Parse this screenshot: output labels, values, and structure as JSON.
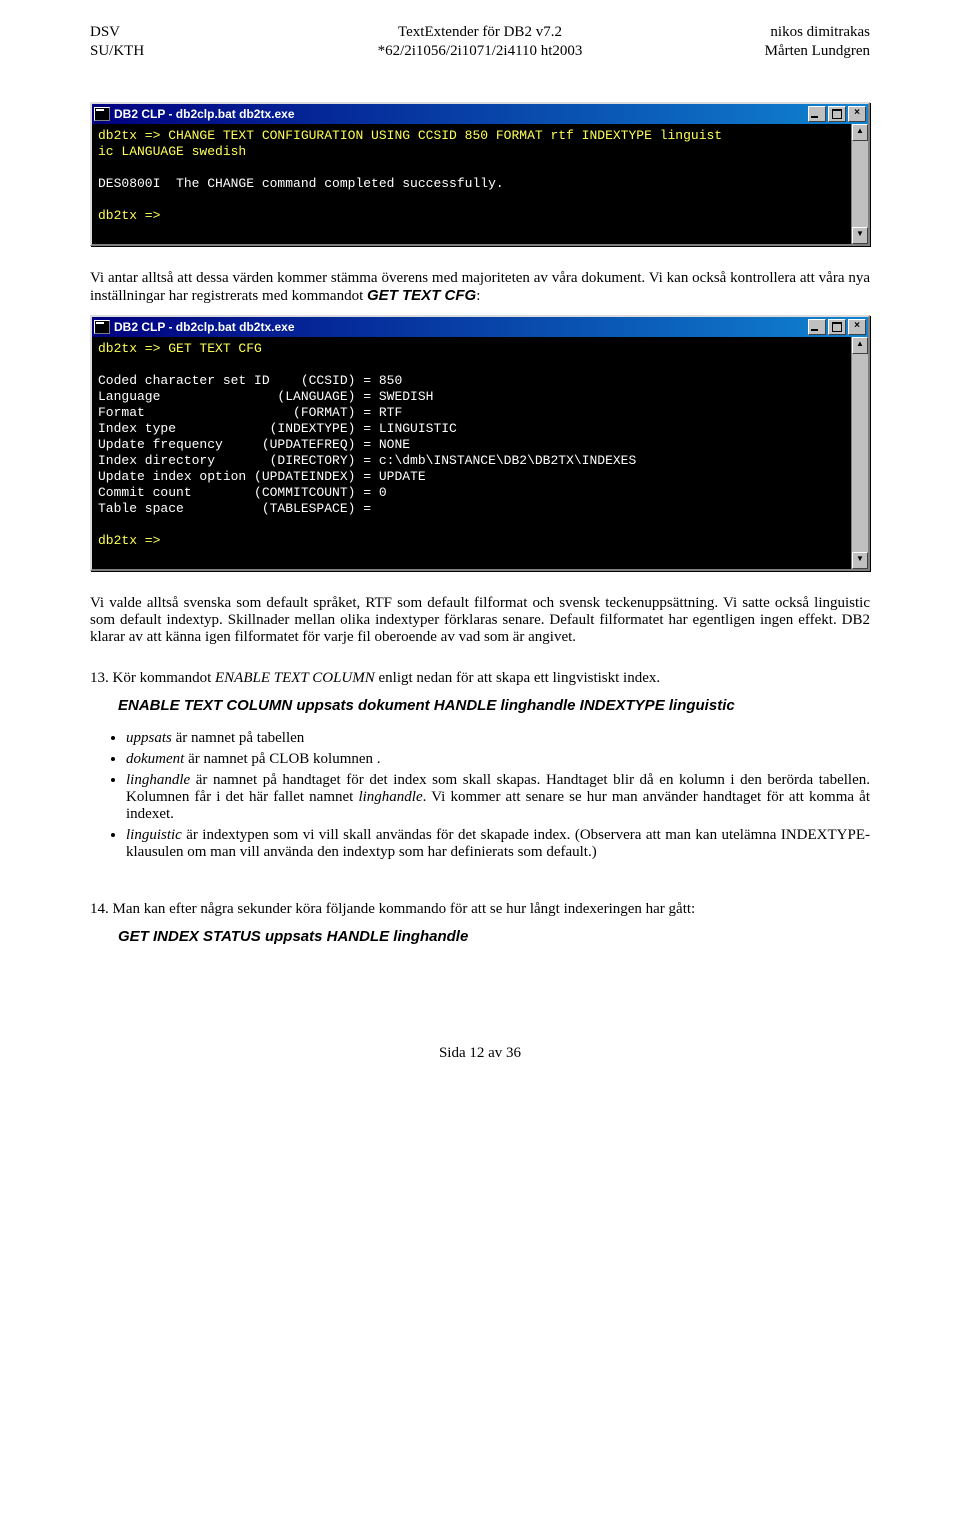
{
  "header": {
    "left1": "DSV",
    "center1": "TextExtender för DB2 v7.2",
    "right1": "nikos dimitrakas",
    "left2": "SU/KTH",
    "center2": "*62/2i1056/2i1071/2i4110 ht2003",
    "right2": "Mårten Lundgren"
  },
  "console1": {
    "title": "DB2 CLP - db2clp.bat db2tx.exe",
    "line1": "db2tx => CHANGE TEXT CONFIGURATION USING CCSID 850 FORMAT rtf INDEXTYPE linguist\nic LANGUAGE swedish",
    "line2": "DES0800I  The CHANGE command completed successfully.",
    "prompt": "db2tx =>"
  },
  "para1": "Vi antar alltså att dessa värden kommer stämma överens med majoriteten av våra dokument. Vi kan också kontrollera att våra nya inställningar har registrerats med kommandot ",
  "para1_cmd": "GET TEXT CFG",
  "para1_end": ":",
  "console2": {
    "title": "DB2 CLP - db2clp.bat db2tx.exe",
    "line1": "db2tx => GET TEXT CFG",
    "lines": "Coded character set ID    (CCSID) = 850\nLanguage               (LANGUAGE) = SWEDISH\nFormat                   (FORMAT) = RTF\nIndex type            (INDEXTYPE) = LINGUISTIC\nUpdate frequency     (UPDATEFREQ) = NONE\nIndex directory       (DIRECTORY) = c:\\dmb\\INSTANCE\\DB2\\DB2TX\\INDEXES\nUpdate index option (UPDATEINDEX) = UPDATE\nCommit count        (COMMITCOUNT) = 0\nTable space          (TABLESPACE) =",
    "prompt": "db2tx =>"
  },
  "para2": "Vi valde alltså svenska som default språket, RTF som default filformat och svensk teckenuppsättning. Vi satte också linguistic som default indextyp. Skillnader mellan olika indextyper förklaras senare. Default filformatet har egentligen ingen effekt. DB2 klarar av att känna igen filformatet för varje fil oberoende av vad som är angivet.",
  "step13_num": "13.",
  "step13a": "Kör kommandot ",
  "step13b": "ENABLE TEXT COLUMN",
  "step13c": " enligt nedan för att skapa ett lingvistiskt index.",
  "cmd13": "ENABLE TEXT COLUMN uppsats dokument HANDLE linghandle INDEXTYPE linguistic",
  "bullets": [
    {
      "pre": "",
      "em": "uppsats",
      "post": " är namnet på tabellen"
    },
    {
      "pre": "",
      "em": "dokument",
      "post": " är namnet på CLOB kolumnen ."
    },
    {
      "pre": "",
      "em": "linghandle",
      "post": " är namnet på handtaget för det index som skall skapas. Handtaget blir då en kolumn i den berörda tabellen. Kolumnen får i det här fallet namnet ",
      "em2": "linghandle",
      "post2": ". Vi kommer att senare se hur man använder handtaget för att komma åt indexet."
    },
    {
      "pre": "",
      "em": "linguistic",
      "post": " är indextypen som vi vill skall användas för det skapade index. (Observera att man kan utelämna INDEXTYPE-klausulen om man vill använda den indextyp som har definierats som default.)"
    }
  ],
  "step14_num": "14.",
  "step14": "Man kan efter några sekunder köra följande kommando för att se hur långt indexeringen har gått:",
  "cmd14": "GET INDEX STATUS uppsats HANDLE linghandle",
  "footer": "Sida 12 av 36",
  "icons": {
    "min": "_",
    "max": "□",
    "close": "×",
    "up": "▲",
    "down": "▼"
  }
}
